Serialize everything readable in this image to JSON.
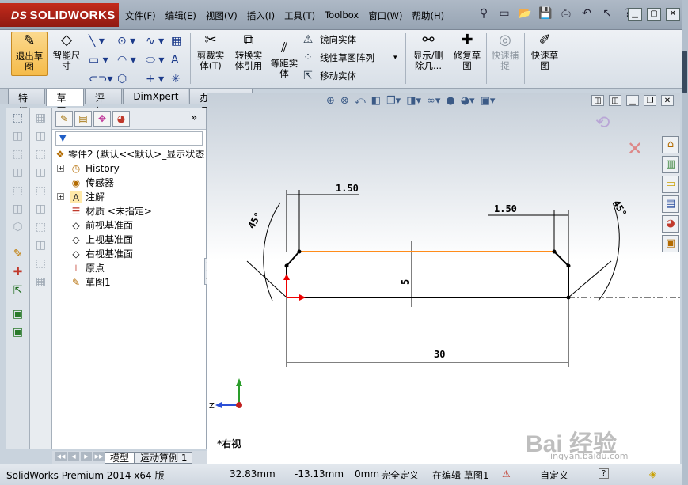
{
  "brand": "SOLIDWORKS",
  "menu": [
    "文件(F)",
    "编辑(E)",
    "视图(V)",
    "插入(I)",
    "工具(T)",
    "Toolbox",
    "窗口(W)",
    "帮助(H)"
  ],
  "commands": {
    "exit_sketch": "退出草图",
    "smart_dim": "智能尺寸",
    "trim": "剪裁实体(T)",
    "convert": "转换实体引用",
    "offset": "等距实体",
    "mirror": "镜向实体",
    "linear_pattern": "线性草图阵列",
    "move": "移动实体",
    "show_delete": "显示/删除几...",
    "repair": "修复草图",
    "quick_snap": "快速捕捉",
    "rapid_sketch": "快速草图"
  },
  "tabs": [
    "特征",
    "草图",
    "评估",
    "DimXpert",
    "办公室产品"
  ],
  "active_tab": "草图",
  "tree": {
    "root": "零件2 (默认<<默认>_显示状态",
    "items": [
      "History",
      "传感器",
      "注解",
      "材质 <未指定>",
      "前视基准面",
      "上视基准面",
      "右视基准面",
      "原点",
      "草图1"
    ]
  },
  "sketch": {
    "dim_top_left": "1.50",
    "dim_top_right": "1.50",
    "angle_left": "45°",
    "angle_right": "45°",
    "dim_height": "5",
    "dim_width": "30"
  },
  "axis_label": "Z",
  "view_label": "*右视",
  "model_tabs": [
    "模型",
    "运动算例 1"
  ],
  "status": {
    "product": "SolidWorks Premium 2014 x64 版",
    "x": "32.83mm",
    "y": "-13.13mm",
    "z": "0mm",
    "state": "完全定义",
    "editing": "在编辑 草图1",
    "units": "自定义"
  },
  "watermark": {
    "main": "Bai 经验",
    "sub": "jingyan.baidu.com"
  },
  "colors": {
    "selected_line": "#ff8c1a",
    "sketch_line": "#000000",
    "brand_red": "#c42b1c"
  }
}
